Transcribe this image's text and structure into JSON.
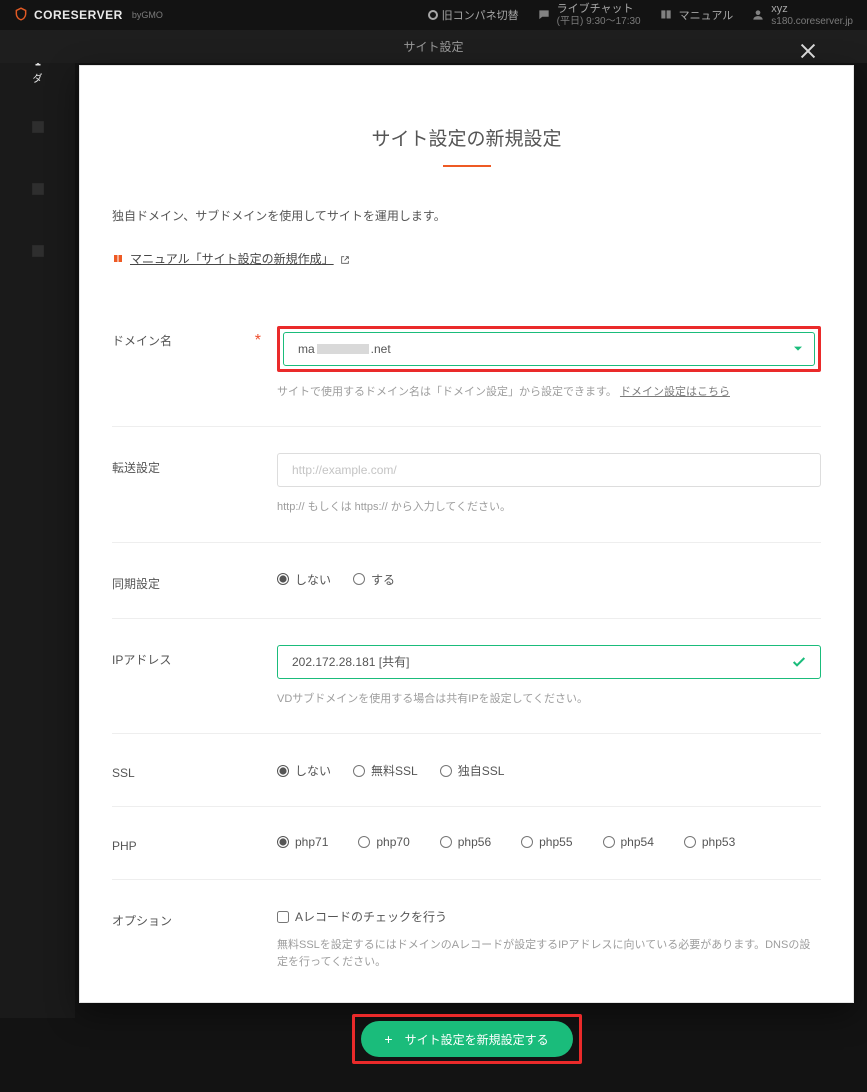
{
  "topbar": {
    "logo_text": "CORESERVER",
    "logo_sub": "byGMO",
    "old_panel_toggle": "旧コンパネ切替",
    "chat": {
      "label": "ライブチャット",
      "hours": "(平日) 9:30〜17:30"
    },
    "manual_link": "マニュアル",
    "user": {
      "name": "xyz",
      "server": "s180.coreserver.jp"
    }
  },
  "leftnav": {
    "dashboard_label": "ダ"
  },
  "secondbar": {
    "title": "サイト設定"
  },
  "modal": {
    "title": "サイト設定の新規設定",
    "intro": "独自ドメイン、サブドメインを使用してサイトを運用します。",
    "manual_link_text": "マニュアル「サイト設定の新規作成」",
    "form": {
      "domain": {
        "label": "ドメイン名",
        "value_prefix": "ma",
        "value_suffix": ".net",
        "hint_pre": "サイトで使用するドメイン名は「ドメイン設定」から設定できます。",
        "hint_link": "ドメイン設定はこちら"
      },
      "forward": {
        "label": "転送設定",
        "placeholder": "http://example.com/",
        "hint": "http:// もしくは https:// から入力してください。"
      },
      "sync": {
        "label": "同期設定",
        "options": [
          "しない",
          "する"
        ],
        "selected": "しない"
      },
      "ip": {
        "label": "IPアドレス",
        "value": "202.172.28.181 [共有]",
        "hint": "VDサブドメインを使用する場合は共有IPを設定してください。"
      },
      "ssl": {
        "label": "SSL",
        "options": [
          "しない",
          "無料SSL",
          "独自SSL"
        ],
        "selected": "しない"
      },
      "php": {
        "label": "PHP",
        "options": [
          "php71",
          "php70",
          "php56",
          "php55",
          "php54",
          "php53"
        ],
        "selected": "php71"
      },
      "option": {
        "label": "オプション",
        "checkbox_label": "Aレコードのチェックを行う",
        "hint": "無料SSLを設定するにはドメインのAレコードが設定するIPアドレスに向いている必要があります。DNSの設定を行ってください。"
      }
    },
    "submit_label": "サイト設定を新規設定する"
  },
  "colors": {
    "accent": "#ee5a24",
    "primary": "#1abc7b",
    "danger": "#ea2a2a"
  }
}
